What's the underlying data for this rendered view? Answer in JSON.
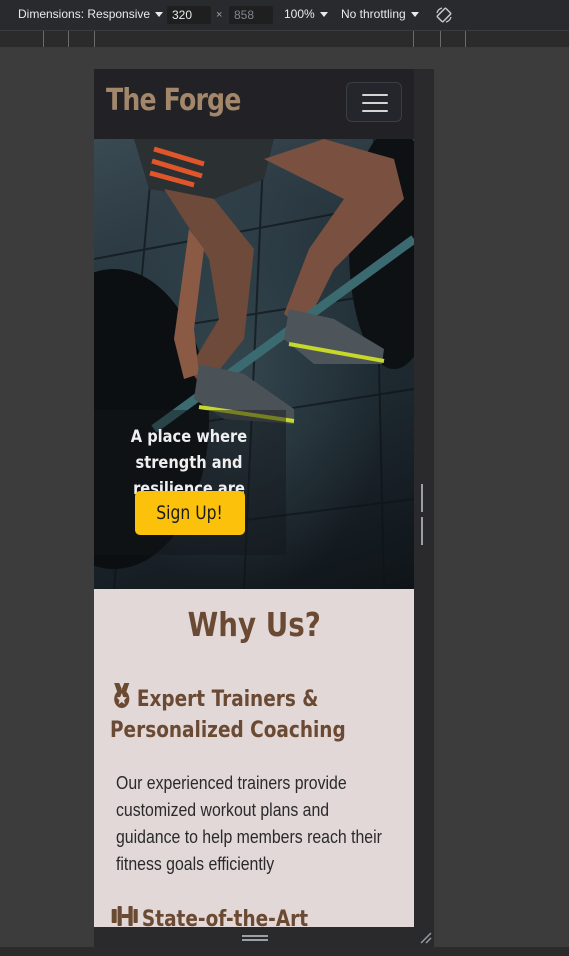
{
  "devtools": {
    "dimensions_label": "Dimensions: Responsive",
    "width_value": "320",
    "times_sign": "×",
    "height_value": "858",
    "zoom_label": "100%",
    "throttling_label": "No throttling"
  },
  "site": {
    "brand": "The Forge",
    "hero": {
      "tagline": "A place where strength and resilience are built!",
      "cta_label": "Sign Up!"
    },
    "why_us": {
      "title": "Why Us?",
      "features": [
        {
          "icon": "medal-icon",
          "title": "Expert Trainers & Personalized Coaching",
          "text": "Our experienced trainers provide customized workout plans and guidance to help members reach their fitness goals efficiently"
        },
        {
          "icon": "dumbbell-icon",
          "title": "State-of-the-Art Equipment"
        }
      ]
    }
  },
  "colors": {
    "brand_text": "#a3876a",
    "cta_background": "#fcc10b",
    "section_background": "#e2d8d8",
    "heading_brown": "#6b4a33"
  }
}
